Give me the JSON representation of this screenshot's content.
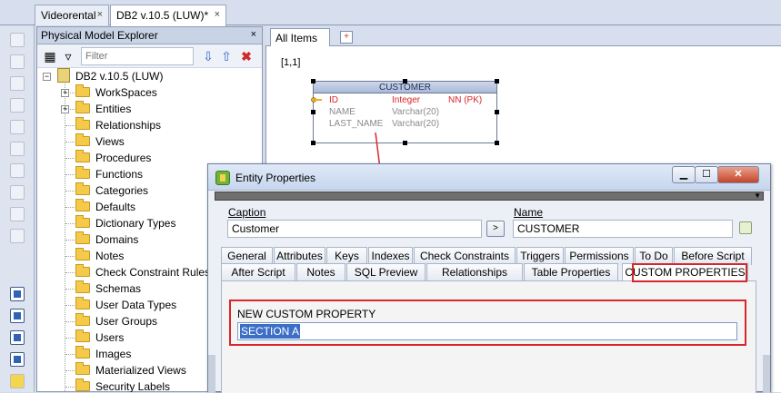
{
  "doc_tabs": [
    {
      "label": "Videorental",
      "close": "×"
    },
    {
      "label": "DB2 v.10.5 (LUW)*",
      "close": "×"
    }
  ],
  "explorer": {
    "title": "Physical Model Explorer",
    "close": "×",
    "filter_placeholder": "Filter",
    "root": "DB2 v.10.5 (LUW)",
    "items": [
      "WorkSpaces",
      "Entities",
      "Relationships",
      "Views",
      "Procedures",
      "Functions",
      "Categories",
      "Defaults",
      "Dictionary Types",
      "Domains",
      "Notes",
      "Check Constraint Rules",
      "Schemas",
      "User Data Types",
      "User Groups",
      "Users",
      "Images",
      "Materialized Views",
      "Security Labels"
    ]
  },
  "diagram": {
    "tab": "All Items",
    "coord": "[1,1]",
    "entity": {
      "name": "CUSTOMER",
      "columns": [
        {
          "name": "ID",
          "type": "Integer",
          "flags": "NN  (PK)"
        },
        {
          "name": "NAME",
          "type": "Varchar(20)",
          "flags": ""
        },
        {
          "name": "LAST_NAME",
          "type": "Varchar(20)",
          "flags": ""
        }
      ]
    }
  },
  "dialog": {
    "title": "Entity Properties",
    "caption_label": "Caption",
    "caption_value": "Customer",
    "name_label": "Name",
    "name_value": "CUSTOMER",
    "mini_button": ">",
    "tabs_row1": [
      "General",
      "Attributes",
      "Keys",
      "Indexes",
      "Check Constraints",
      "Triggers",
      "Permissions",
      "To Do",
      "Before Script"
    ],
    "tabs_row2": [
      "After Script",
      "Notes",
      "SQL Preview",
      "Relationships",
      "Table Properties",
      "CUSTOM PROPERTIES"
    ],
    "custom_property_label": "NEW CUSTOM PROPERTY",
    "custom_property_value": "SECTION A"
  },
  "colors": {
    "highlight": "#d9262a",
    "selection": "#3b6fc7",
    "pk_red": "#d9262a"
  }
}
